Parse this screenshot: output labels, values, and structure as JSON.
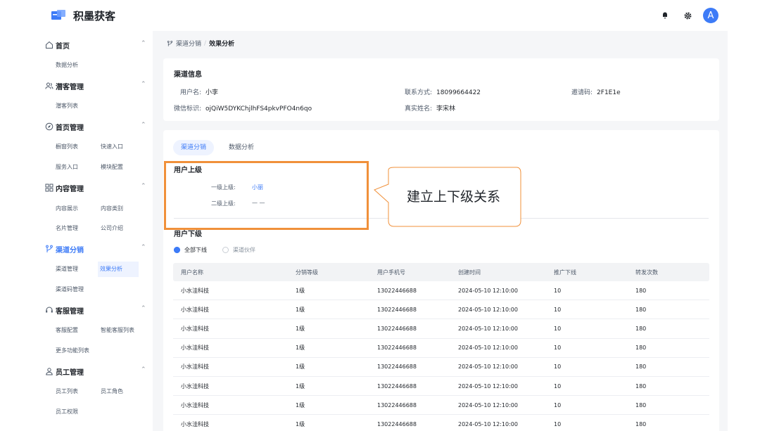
{
  "app": {
    "title": "积墨获客",
    "avatar_letter": "A"
  },
  "sidebar": {
    "groups": [
      {
        "label": "首页",
        "icon": "home-icon",
        "items": [
          "数据分析"
        ]
      },
      {
        "label": "潜客管理",
        "icon": "users-icon",
        "items": [
          "潜客列表"
        ]
      },
      {
        "label": "首页管理",
        "icon": "compass-icon",
        "items": [
          "橱窗列表",
          "快速入口",
          "服务入口",
          "模块配置"
        ]
      },
      {
        "label": "内容管理",
        "icon": "grid-icon",
        "items": [
          "内容展示",
          "内容类别",
          "名片管理",
          "公司介绍"
        ]
      },
      {
        "label": "渠道分销",
        "icon": "branch-icon",
        "active": true,
        "items": [
          "渠道管理",
          "效果分析",
          "渠道码管理"
        ]
      },
      {
        "label": "客服管理",
        "icon": "headset-icon",
        "items": [
          "客服配置",
          "智能客服列表",
          "更多功能列表"
        ]
      },
      {
        "label": "员工管理",
        "icon": "user-icon",
        "items": [
          "员工列表",
          "员工角色",
          "员工权限"
        ]
      }
    ]
  },
  "breadcrumb": {
    "parent": "渠道分销",
    "separator": "/",
    "current": "效果分析"
  },
  "channel_info": {
    "title": "渠道信息",
    "username_label": "用户名:",
    "username": "小李",
    "contact_label": "联系方式:",
    "contact": "18099664422",
    "invite_label": "邀请码:",
    "invite": "2F1E1e",
    "wechat_label": "微信标识:",
    "wechat": "ojQiW5DYKChjlhFS4pkvPFO4n6qo",
    "realname_label": "真实姓名:",
    "realname": "李宋林"
  },
  "tabs": {
    "distribution": "渠道分销",
    "analysis": "数据分析"
  },
  "upper": {
    "title": "用户上级",
    "level1_label": "一级上级:",
    "level1_value": "小丽",
    "level2_label": "二级上级:",
    "level2_value": "— —"
  },
  "lower": {
    "title": "用户下级",
    "radio_all": "全部下线",
    "radio_partner": "渠道伙伴"
  },
  "table": {
    "headers": [
      "用户名称",
      "分销等级",
      "用户手机号",
      "创建时间",
      "推广下线",
      "转发次数"
    ],
    "rows": [
      [
        "小水洼科技",
        "1级",
        "13022446688",
        "2024-05-10 12:10:00",
        "10",
        "180"
      ],
      [
        "小水洼科技",
        "1级",
        "13022446688",
        "2024-05-10 12:10:00",
        "10",
        "180"
      ],
      [
        "小水洼科技",
        "1级",
        "13022446688",
        "2024-05-10 12:10:00",
        "10",
        "180"
      ],
      [
        "小水洼科技",
        "1级",
        "13022446688",
        "2024-05-10 12:10:00",
        "10",
        "180"
      ],
      [
        "小水洼科技",
        "1级",
        "13022446688",
        "2024-05-10 12:10:00",
        "10",
        "180"
      ],
      [
        "小水洼科技",
        "1级",
        "13022446688",
        "2024-05-10 12:10:00",
        "10",
        "180"
      ],
      [
        "小水洼科技",
        "1级",
        "13022446688",
        "2024-05-10 12:10:00",
        "10",
        "180"
      ],
      [
        "小水洼科技",
        "1级",
        "13022446688",
        "2024-05-10 12:10:00",
        "10",
        "180"
      ]
    ]
  },
  "annotation": {
    "text": "建立上下级关系",
    "box_color": "#f0903a"
  },
  "colors": {
    "accent": "#3d7bf7",
    "background": "#f5f6f8"
  }
}
